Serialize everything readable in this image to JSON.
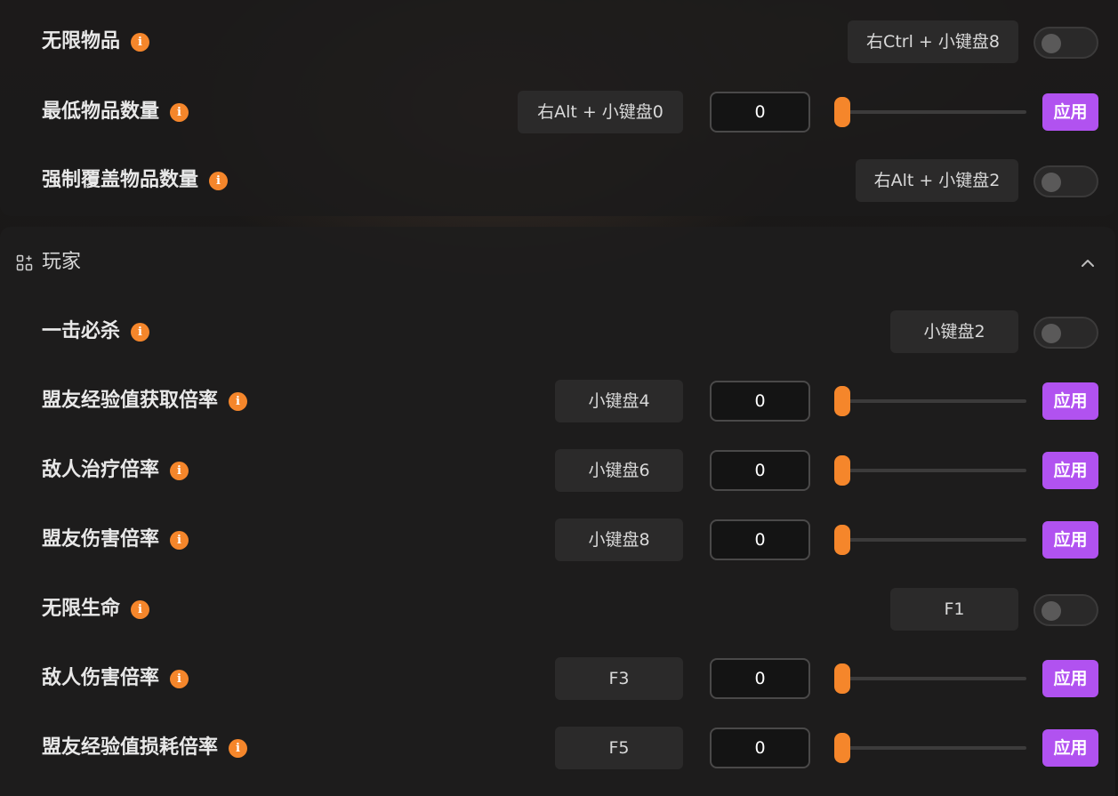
{
  "item_rows": [
    {
      "label": "无限物品",
      "hotkey": "右Ctrl + 小键盘8",
      "control": "toggle",
      "on": false
    },
    {
      "label": "最低物品数量",
      "hotkey": "右Alt + 小键盘0",
      "control": "slider",
      "value": "0",
      "slider_fraction": 0,
      "apply": "应用"
    },
    {
      "label": "强制覆盖物品数量",
      "hotkey": "右Alt + 小键盘2",
      "control": "toggle",
      "on": false
    }
  ],
  "player_section": {
    "title": "玩家",
    "icon": "grid-add-icon",
    "collapse_icon": "chevron-up-icon",
    "rows": [
      {
        "label": "一击必杀",
        "hotkey": "小键盘2",
        "control": "toggle",
        "on": false
      },
      {
        "label": "盟友经验值获取倍率",
        "hotkey": "小键盘4",
        "control": "slider",
        "value": "0",
        "slider_fraction": 0,
        "apply": "应用"
      },
      {
        "label": "敌人治疗倍率",
        "hotkey": "小键盘6",
        "control": "slider",
        "value": "0",
        "slider_fraction": 0,
        "apply": "应用"
      },
      {
        "label": "盟友伤害倍率",
        "hotkey": "小键盘8",
        "control": "slider",
        "value": "0",
        "slider_fraction": 0,
        "apply": "应用"
      },
      {
        "label": "无限生命",
        "hotkey": "F1",
        "control": "toggle",
        "on": false
      },
      {
        "label": "敌人伤害倍率",
        "hotkey": "F3",
        "control": "slider",
        "value": "0",
        "slider_fraction": 0,
        "apply": "应用"
      },
      {
        "label": "盟友经验值损耗倍率",
        "hotkey": "F5",
        "control": "slider",
        "value": "0",
        "slider_fraction": 0,
        "apply": "应用"
      }
    ]
  },
  "info_icon_glyph": "i",
  "colors": {
    "accent_orange": "#f5862b",
    "apply_purple": "#b152f0",
    "panel": "#1c1b1b"
  }
}
